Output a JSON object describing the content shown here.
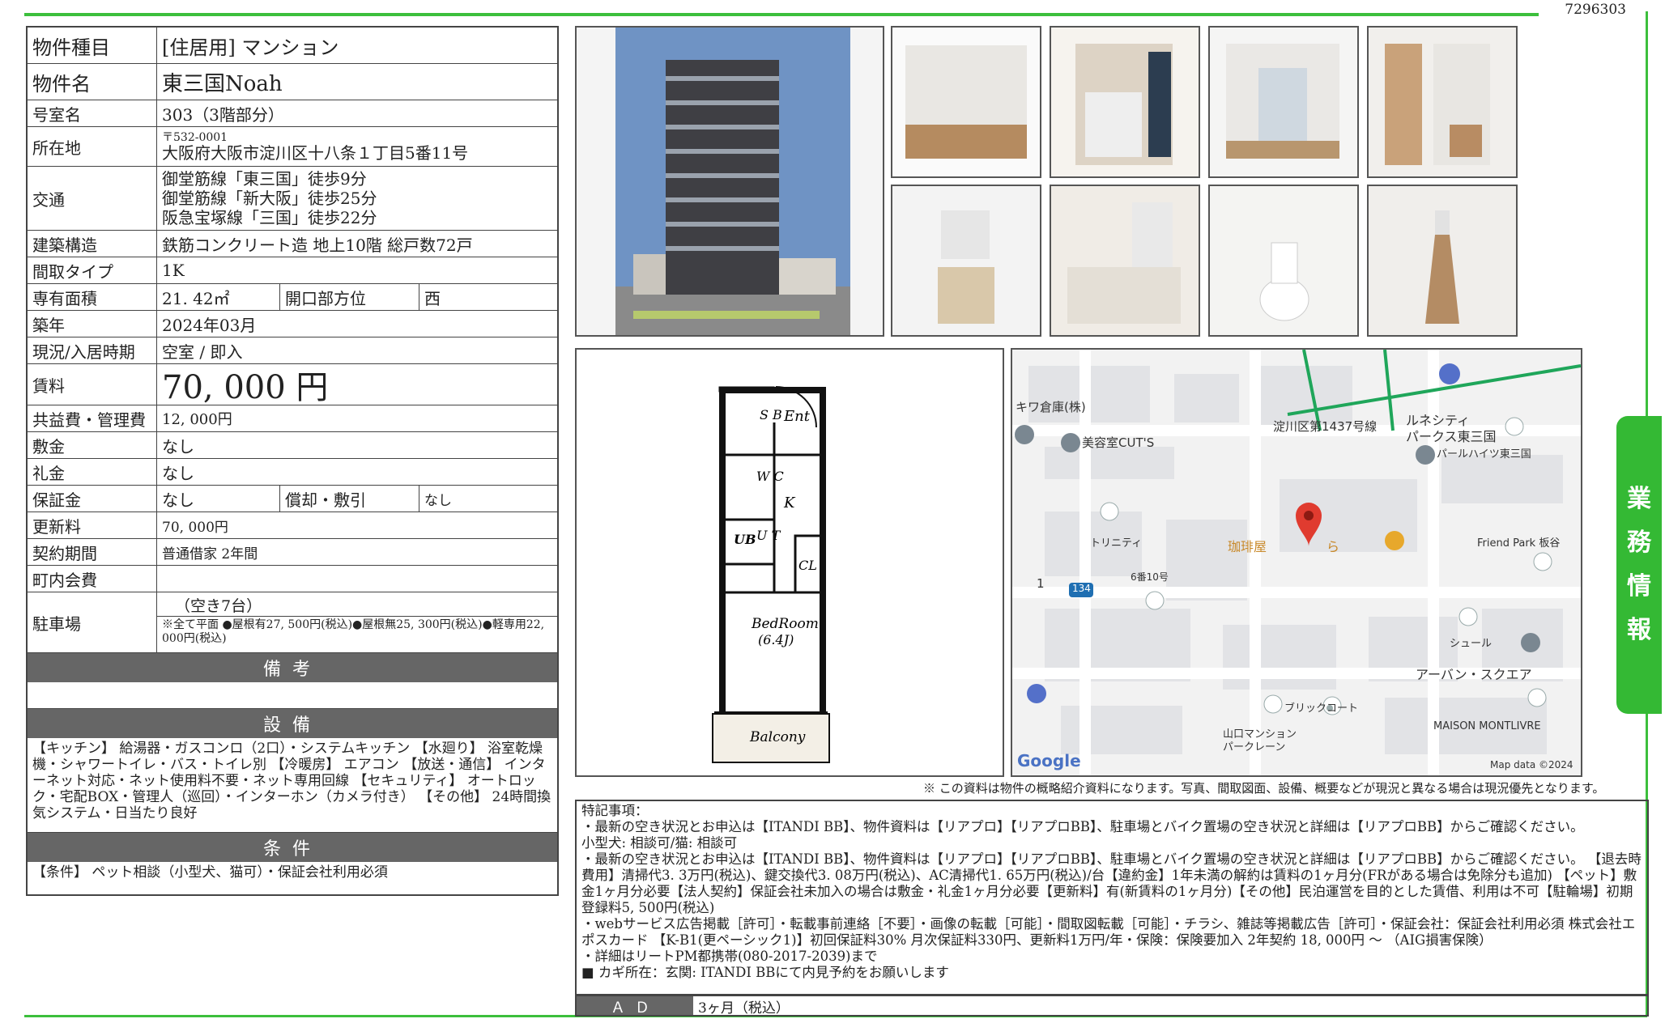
{
  "doc_id": "7296303",
  "info": {
    "type_label": "物件種目",
    "type_value": "[住居用]  マンション",
    "name_label": "物件名",
    "name_value": "東三国Noah",
    "room_label": "号室名",
    "room_value": "303（3階部分）",
    "addr_label": "所在地",
    "addr_zip": "〒532-0001",
    "addr_value": "大阪府大阪市淀川区十八条１丁目5番11号",
    "traffic_label": "交通",
    "traffic": [
      "御堂筋線「東三国」徒歩9分",
      "御堂筋線「新大阪」徒歩25分",
      "阪急宝塚線「三国」徒歩22分"
    ],
    "struct_label": "建築構造",
    "struct_value": "鉄筋コンクリート造 地上10階 総戸数72戸",
    "layout_label": "間取タイプ",
    "layout_value": "1K",
    "area_label": "専有面積",
    "area_value": "21. 42㎡",
    "dir_label": "開口部方位",
    "dir_value": "西",
    "built_label": "築年",
    "built_value": "2024年03月",
    "status_label": "現況/入居時期",
    "status_value": "空室  /  即入",
    "rent_label": "賃料",
    "rent_value": "70, 000  円",
    "fee_label": "共益費・管理費",
    "fee_value": "12, 000円",
    "deposit_label": "敷金",
    "deposit_value": "なし",
    "key_label": "礼金",
    "key_value": "なし",
    "guarantee_label": "保証金",
    "guarantee_value": "なし",
    "amort_label": "償却・敷引",
    "amort_value": "なし",
    "renew_label": "更新料",
    "renew_value": "70, 000円",
    "contract_label": "契約期間",
    "contract_value": "普通借家  2年間",
    "town_label": "町内会費",
    "town_value": "",
    "parking_label": "駐車場",
    "parking_vacancy": "（空き7台）",
    "parking_note": "※全て平面  ●屋根有27, 500円(税込)●屋根無25, 300円(税込)●軽専用22, 000円(税込)"
  },
  "sections": {
    "remarks_title": "備考",
    "equip_title": "設備",
    "equip_text": "【キッチン】 給湯器・ガスコンロ（2口）・システムキッチン 【水廻り】 浴室乾燥機・シャワートイレ・バス・トイレ別 【冷暖房】 エアコン 【放送・通信】 インターネット対応・ネット使用料不要・ネット専用回線 【セキュリティ】 オートロック・宅配BOX・管理人（巡回）・インターホン（カメラ付き） 【その他】 24時間換気システム・日当たり良好",
    "cond_title": "条件",
    "cond_text": "【条件】 ペット相談（小型犬、猫可）・保証会社利用必須"
  },
  "floorplan": {
    "sb": "S B",
    "ent": "Ent",
    "wc": "W C",
    "ut": "U T",
    "k": "K",
    "ub": "UB",
    "cl": "CL",
    "bedroom": "BedRoom",
    "bedroom_size": "(6.4J)",
    "balcony": "Balcony"
  },
  "map": {
    "labels": [
      "キワ倉庫(株)",
      "美容室CUT'S",
      "淀川区第1437号線",
      "ルネシティ",
      "パークス東三国",
      "パールハイツ東三国",
      "トリニティ",
      "珈琲屋",
      "ら",
      "Friend Park 板谷",
      "6番10号",
      "1",
      "134",
      "シュール",
      "アーバン・スクエア",
      "ブリックコート",
      "山口マンション",
      "パークレーン",
      "MAISON MONTLIVRE"
    ],
    "google": "Google",
    "attribution": "Map data ©2024"
  },
  "disclaimer": "※  この資料は物件の概略紹介資料になります。写真、間取図面、設備、概要などが現況と異なる場合は現況優先となります。",
  "remarks_lines": [
    "特記事項：",
    "・最新の空き状況とお申込は【ITANDI  BB】、物件資料は【リアプロ】【リアプロBB】、駐車場とバイク置場の空き状況と詳細は【リアプロBB】からご確認ください。",
    "小型犬: 相談可/猫: 相談可",
    "・最新の空き状況とお申込は【ITANDI  BB】、物件資料は【リアプロ】【リアプロBB】、駐車場とバイク置場の空き状況と詳細は【リアプロBB】からご確認ください。 【退去時費用】清掃代3. 3万円(税込)、鍵交換代3. 08万円(税込)、AC清掃代1. 65万円(税込)/台【違約金】1年未満の解約は賃料の1ヶ月分(FRがある場合は免除分も追加) 【ペット】敷金1ヶ月分必要【法人契約】保証会社未加入の場合は敷金・礼金1ヶ月分必要【更新料】有(新賃料の1ヶ月分)【その他】民泊運営を目的とした賃借、利用は不可【駐輪場】初期登録料5, 500円(税込)",
    "・webサービス広告掲載［許可］・転載事前連絡［不要］・画像の転載［可能］・間取図転載［可能］・チラシ、雑誌等掲載広告［許可］・保証会社：保証会社利用必須 株式会社エポスカード 【K-B1(更ペーシック1)】初回保証料30% 月次保証料330円、更新料1万円/年・保険：保険要加入 2年契約 18, 000円 ～ （AIG損害保険）",
    "・詳細はリートPM都携帯(080-2017-2039)まで",
    "■  カギ所在：玄関: ITANDI  BBにて内見予約をお願いします"
  ],
  "ad_label": "ＡＤ",
  "ad_value": "3ヶ月（税込）",
  "side_tab": [
    "業",
    "務",
    "情",
    "報"
  ],
  "colors": {
    "accent_green": "#34b934",
    "section_bar": "#666666"
  }
}
